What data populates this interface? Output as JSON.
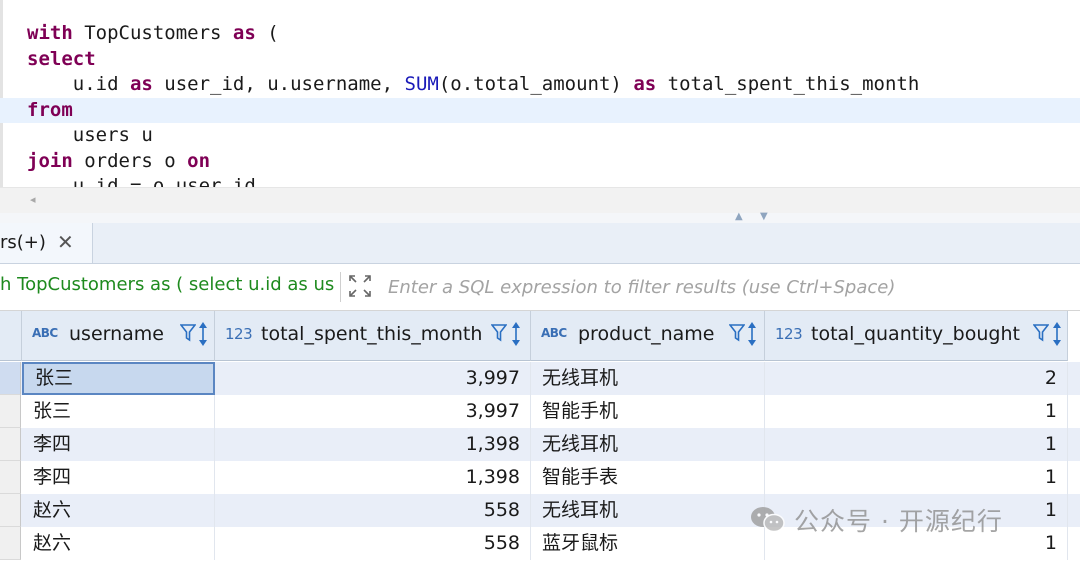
{
  "editor": {
    "lines": [
      [
        {
          "t": "with",
          "c": "kw"
        },
        {
          "t": " TopCustomers ",
          "c": ""
        },
        {
          "t": "as",
          "c": "kw"
        },
        {
          "t": " (",
          "c": ""
        }
      ],
      [
        {
          "t": "select",
          "c": "kw"
        }
      ],
      [
        {
          "t": "    u.id ",
          "c": ""
        },
        {
          "t": "as",
          "c": "kw"
        },
        {
          "t": " user_id, u.username, ",
          "c": ""
        },
        {
          "t": "SUM",
          "c": "fn"
        },
        {
          "t": "(o.total_amount) ",
          "c": ""
        },
        {
          "t": "as",
          "c": "kw"
        },
        {
          "t": " total_spent_this_month",
          "c": ""
        }
      ],
      [
        {
          "t": "from",
          "c": "kw"
        }
      ],
      [
        {
          "t": "    users u",
          "c": ""
        }
      ],
      [
        {
          "t": "join",
          "c": "kw"
        },
        {
          "t": " orders o ",
          "c": ""
        },
        {
          "t": "on",
          "c": "kw"
        }
      ],
      [
        {
          "t": "    u.id = o.user_id",
          "c": ""
        }
      ]
    ],
    "current_line": 3
  },
  "scrollbar": {
    "left_arrow": "◂"
  },
  "splitter": {
    "up": "▲",
    "down": "▼"
  },
  "results_tab": {
    "label": "rs(+)",
    "close_icon": "close-icon"
  },
  "filter": {
    "query_text": "h TopCustomers as ( select u.id as us",
    "placeholder": "Enter a SQL expression to filter results (use Ctrl+Space)",
    "expand_icon": "expand-icon"
  },
  "grid": {
    "columns": [
      {
        "type_badge": "ABC",
        "name": "username"
      },
      {
        "type_badge": "123",
        "name": "total_spent_this_month"
      },
      {
        "type_badge": "ABC",
        "name": "product_name"
      },
      {
        "type_badge": "123",
        "name": "total_quantity_bought"
      }
    ],
    "rows": [
      [
        "张三",
        "3,997",
        "无线耳机",
        "2"
      ],
      [
        "张三",
        "3,997",
        "智能手机",
        "1"
      ],
      [
        "李四",
        "1,398",
        "无线耳机",
        "1"
      ],
      [
        "李四",
        "1,398",
        "智能手表",
        "1"
      ],
      [
        "赵六",
        "558",
        "无线耳机",
        "1"
      ],
      [
        "赵六",
        "558",
        "蓝牙鼠标",
        "1"
      ]
    ],
    "selected_row": 0
  },
  "watermark": {
    "text": "公众号 · 开源纪行"
  },
  "colors": {
    "keyword": "#7f0055",
    "function": "#1a1ab8",
    "filter_query": "#1e8a1e",
    "header_bg": "#e3ebf5",
    "selected_cell": "#c7d8ee"
  }
}
